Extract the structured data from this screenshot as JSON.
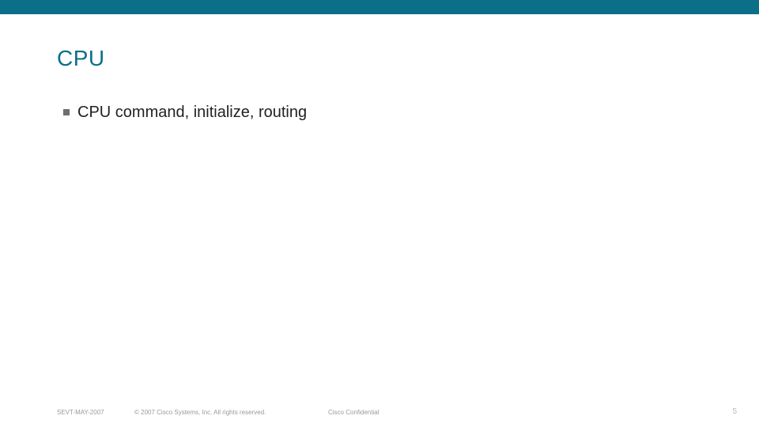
{
  "colors": {
    "topbar": "#0b6f88",
    "title": "#0b6f88"
  },
  "title": "CPU",
  "bullet": "CPU  command, initialize, routing",
  "footer": {
    "id": "SEVT-MAY-2007",
    "copyright": "© 2007 Cisco Systems, Inc. All rights reserved.",
    "confidential": "Cisco Confidential",
    "page": "5"
  }
}
